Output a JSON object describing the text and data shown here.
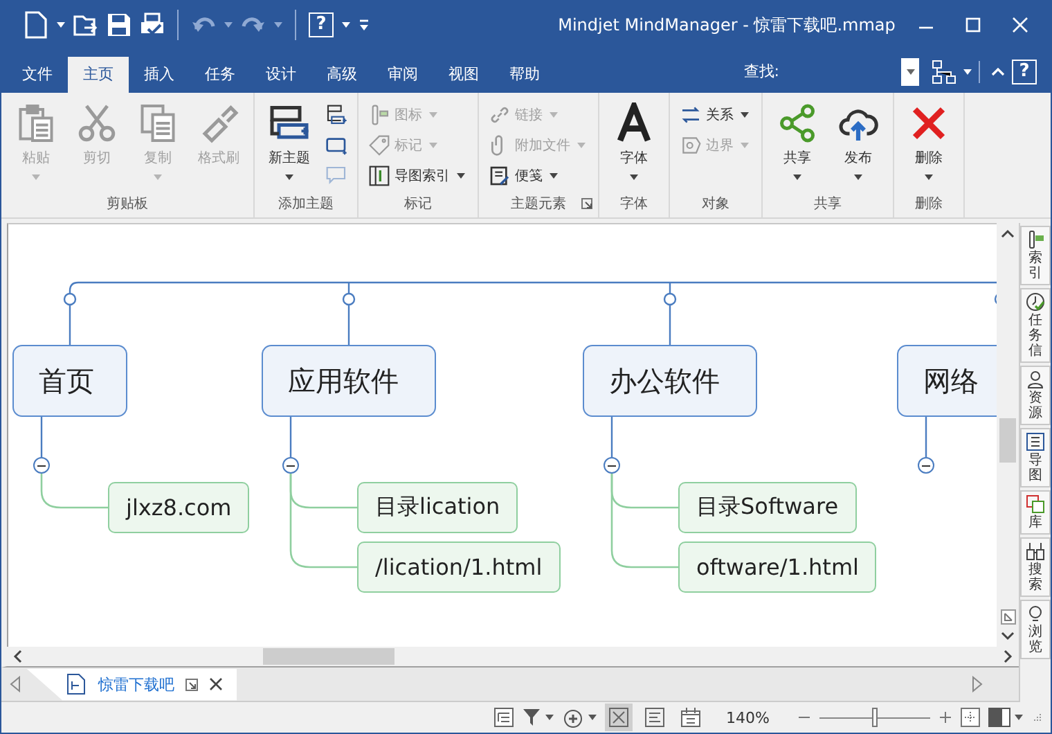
{
  "window": {
    "title": "Mindjet MindManager - 惊雷下载吧.mmap",
    "help_glyph": "?"
  },
  "tabs": [
    {
      "label": "文件",
      "selected": false
    },
    {
      "label": "主页",
      "selected": true
    },
    {
      "label": "插入",
      "selected": false
    },
    {
      "label": "任务",
      "selected": false
    },
    {
      "label": "设计",
      "selected": false
    },
    {
      "label": "高级",
      "selected": false
    },
    {
      "label": "审阅",
      "selected": false
    },
    {
      "label": "视图",
      "selected": false
    },
    {
      "label": "帮助",
      "selected": false
    }
  ],
  "search": {
    "label": "查找:",
    "help_glyph": "?"
  },
  "ribbon": {
    "groups": [
      {
        "label": "剪贴板",
        "items": [
          {
            "kind": "large",
            "label": "粘贴",
            "disabled": true,
            "dropdown": true
          },
          {
            "kind": "large",
            "label": "剪切",
            "disabled": true,
            "dropdown": false
          },
          {
            "kind": "large",
            "label": "复制",
            "disabled": true,
            "dropdown": true
          },
          {
            "kind": "large",
            "label": "格式刷",
            "disabled": true,
            "dropdown": false
          }
        ]
      },
      {
        "label": "添加主题",
        "items": [
          {
            "kind": "large",
            "label": "新主题",
            "disabled": false,
            "dropdown": true
          },
          {
            "kind": "icon",
            "disabled": false
          },
          {
            "kind": "icon",
            "disabled": false
          },
          {
            "kind": "icon",
            "disabled": true
          }
        ]
      },
      {
        "label": "标记",
        "items": [
          {
            "kind": "small",
            "label": "图标",
            "disabled": true,
            "dropdown": true
          },
          {
            "kind": "small",
            "label": "标记",
            "disabled": true,
            "dropdown": true
          },
          {
            "kind": "small",
            "label": "导图索引",
            "disabled": false,
            "dropdown": true
          }
        ]
      },
      {
        "label": "主题元素",
        "launcher": true,
        "items": [
          {
            "kind": "small",
            "label": "链接",
            "disabled": true,
            "dropdown": true
          },
          {
            "kind": "small",
            "label": "附加文件",
            "disabled": true,
            "dropdown": true
          },
          {
            "kind": "small",
            "label": "便笺",
            "disabled": false,
            "dropdown": true
          }
        ]
      },
      {
        "label": "字体",
        "items": [
          {
            "kind": "large",
            "label": "字体",
            "disabled": false,
            "dropdown": true
          }
        ]
      },
      {
        "label": "对象",
        "items": [
          {
            "kind": "small",
            "label": "关系",
            "disabled": false,
            "dropdown": true
          },
          {
            "kind": "small",
            "label": "边界",
            "disabled": true,
            "dropdown": true
          }
        ]
      },
      {
        "label": "共享",
        "items": [
          {
            "kind": "large",
            "label": "共享",
            "disabled": false,
            "dropdown": true
          },
          {
            "kind": "large",
            "label": "发布",
            "disabled": false,
            "dropdown": true
          }
        ]
      },
      {
        "label": "删除",
        "items": [
          {
            "kind": "large",
            "label": "删除",
            "disabled": false,
            "dropdown": true
          }
        ]
      }
    ]
  },
  "map": {
    "topics": [
      {
        "label": "首页",
        "expanded": true,
        "children": [
          {
            "label": "jlxz8.com"
          }
        ]
      },
      {
        "label": "应用软件",
        "expanded": true,
        "children": [
          {
            "label": "目录lication"
          },
          {
            "label": "/lication/1.html"
          }
        ]
      },
      {
        "label": "办公软件",
        "expanded": true,
        "children": [
          {
            "label": "目录Software"
          },
          {
            "label": "oftware/1.html"
          }
        ]
      },
      {
        "label": "网络",
        "expanded": true
      }
    ]
  },
  "side_panel": {
    "tabs": [
      {
        "label": "索引"
      },
      {
        "label": "任务信"
      },
      {
        "label": "资源"
      },
      {
        "label": "导图"
      },
      {
        "label": "库"
      },
      {
        "label": "搜索"
      },
      {
        "label": "浏览"
      }
    ]
  },
  "document_tabs": [
    {
      "label": "惊雷下载吧",
      "selected": true
    }
  ],
  "status_bar": {
    "views": [
      {
        "selected": true
      },
      {
        "selected": false
      },
      {
        "selected": false
      }
    ],
    "zoom": {
      "reading": "140%",
      "level": 0.5
    }
  }
}
